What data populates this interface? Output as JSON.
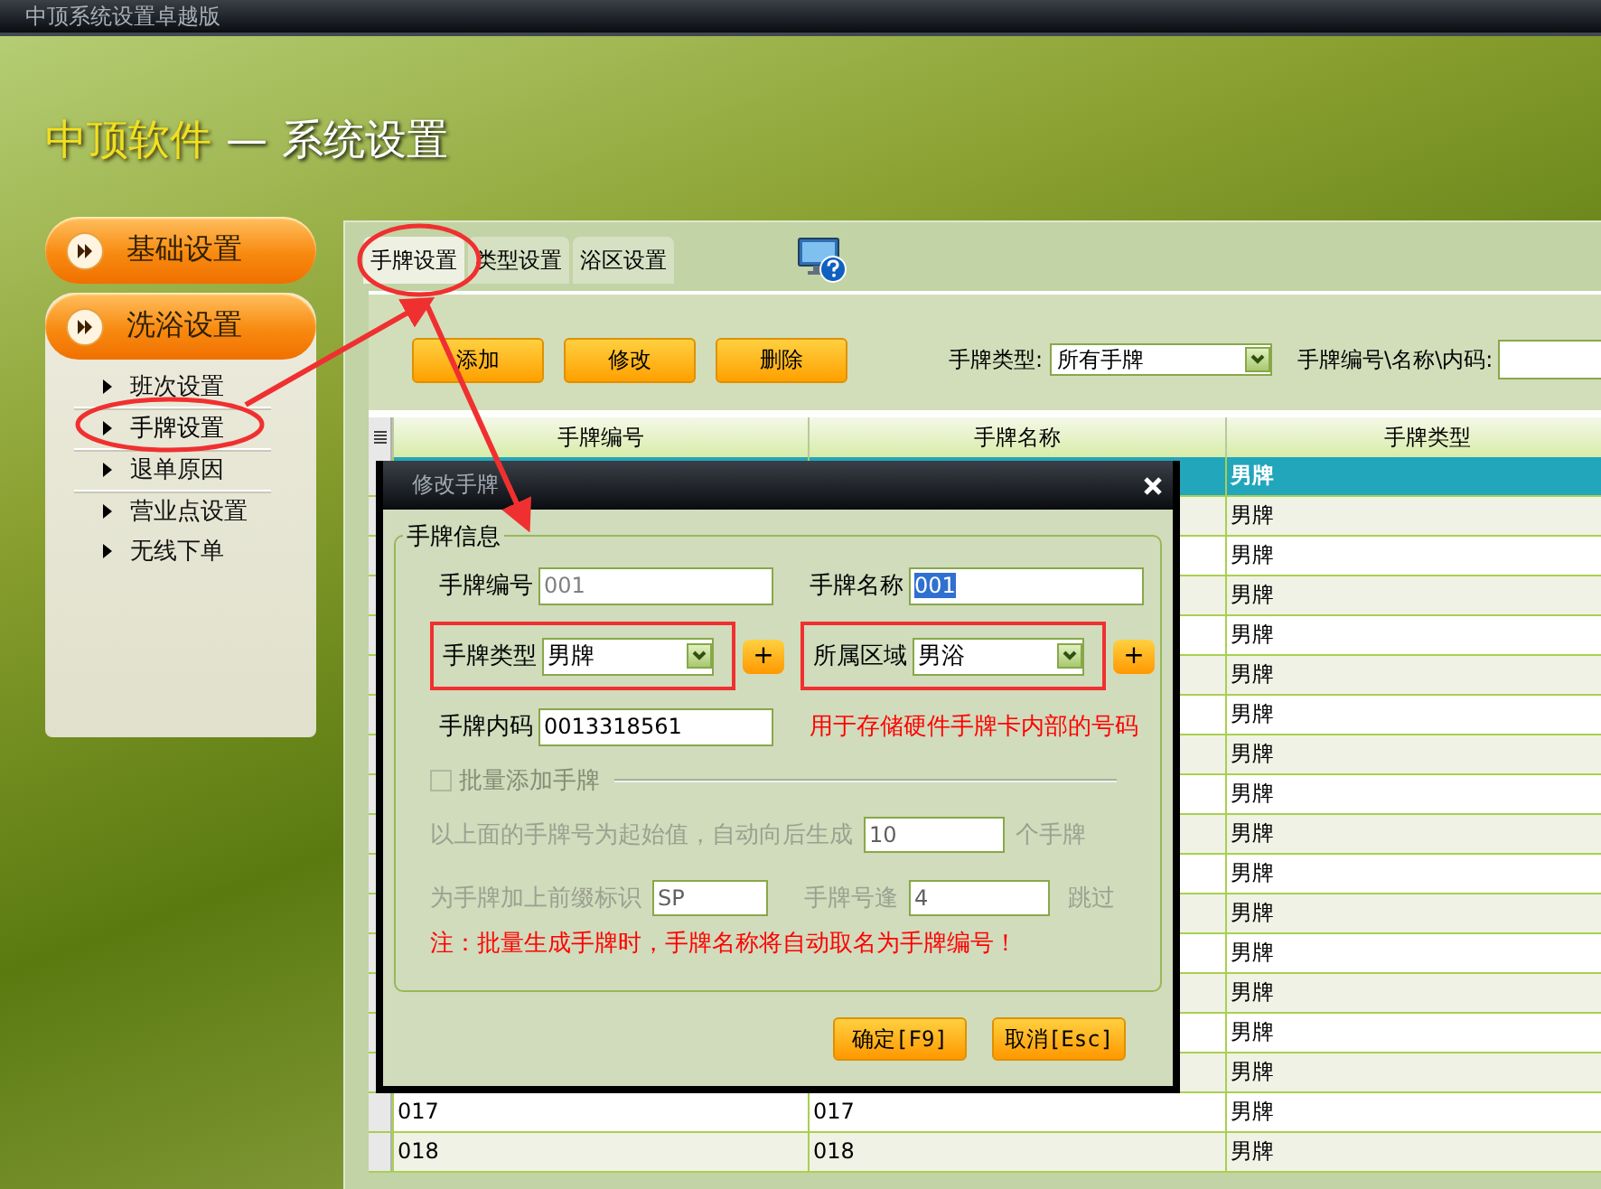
{
  "window": {
    "title": "中顶系统设置卓越版"
  },
  "header": {
    "brand": "中顶软件",
    "separator": "—",
    "title": "系统设置"
  },
  "sidebar": {
    "groups": [
      {
        "label": "基础设置",
        "expanded": false
      },
      {
        "label": "洗浴设置",
        "expanded": true,
        "items": [
          {
            "label": "班次设置",
            "selected": false
          },
          {
            "label": "手牌设置",
            "selected": true
          },
          {
            "label": "退单原因",
            "selected": false
          },
          {
            "label": "营业点设置",
            "selected": false
          },
          {
            "label": "无线下单",
            "selected": false
          }
        ]
      }
    ]
  },
  "tabs": [
    {
      "label": "手牌设置",
      "selected": true
    },
    {
      "label": "类型设置",
      "selected": false
    },
    {
      "label": "浴区设置",
      "selected": false
    }
  ],
  "toolbar": {
    "buttons": [
      "添加",
      "修改",
      "删除"
    ],
    "type_filter": {
      "label": "手牌类型:",
      "value": "所有手牌"
    },
    "search": {
      "label": "手牌编号\\名称\\内码:"
    }
  },
  "table": {
    "columns": [
      "手牌编号",
      "手牌名称",
      "手牌类型"
    ],
    "rows": [
      {
        "type": "男牌",
        "selected": true
      },
      {
        "type": "男牌",
        "selected": false
      },
      {
        "type": "男牌",
        "selected": false
      },
      {
        "type": "男牌",
        "selected": false
      },
      {
        "type": "男牌",
        "selected": false
      },
      {
        "type": "男牌",
        "selected": false
      },
      {
        "type": "男牌",
        "selected": false
      },
      {
        "type": "男牌",
        "selected": false
      },
      {
        "type": "男牌",
        "selected": false
      },
      {
        "type": "男牌",
        "selected": false
      },
      {
        "type": "男牌",
        "selected": false
      },
      {
        "type": "男牌",
        "selected": false
      },
      {
        "type": "男牌",
        "selected": false
      },
      {
        "type": "男牌",
        "selected": false
      },
      {
        "type": "男牌",
        "selected": false
      },
      {
        "type": "男牌",
        "selected": false
      },
      {
        "code": "017",
        "name": "017",
        "type": "男牌",
        "selected": false
      },
      {
        "code": "018",
        "name": "018",
        "type": "男牌",
        "selected": false
      }
    ]
  },
  "dialog": {
    "title": "修改手牌",
    "group": "手牌信息",
    "fields": [
      {
        "kind": "text",
        "label": "手牌编号",
        "value": "001",
        "disabled": true,
        "text_selected": false,
        "highlighted": false
      },
      {
        "kind": "text",
        "label": "手牌名称",
        "value": "001",
        "disabled": false,
        "text_selected": true,
        "highlighted": false
      },
      {
        "kind": "select",
        "label": "手牌类型",
        "value": "男牌",
        "add_button": "+",
        "highlighted": true
      },
      {
        "kind": "select",
        "label": "所属区域",
        "value": "男浴",
        "add_button": "+",
        "highlighted": true
      },
      {
        "kind": "text",
        "label": "手牌内码",
        "value": "0013318561",
        "disabled": false,
        "text_selected": false,
        "highlighted": false
      },
      {
        "kind": "note",
        "text": "用于存储硬件手牌卡内部的号码"
      }
    ],
    "batch": {
      "label": "批量添加手牌",
      "checked": false,
      "disabled": true,
      "count_prefix": "以上面的手牌号为起始值，自动向后生成",
      "count": "10",
      "count_suffix": "个手牌",
      "prefix_label": "为手牌加上前缀标识",
      "prefix": "SP",
      "skip_label": "手牌号逢",
      "skip": "4",
      "skip_suffix": "跳过"
    },
    "note": "注：批量生成手牌时，手牌名称将自动取名为手牌编号！",
    "buttons": [
      "确定[F9]",
      "取消[Esc]"
    ]
  }
}
